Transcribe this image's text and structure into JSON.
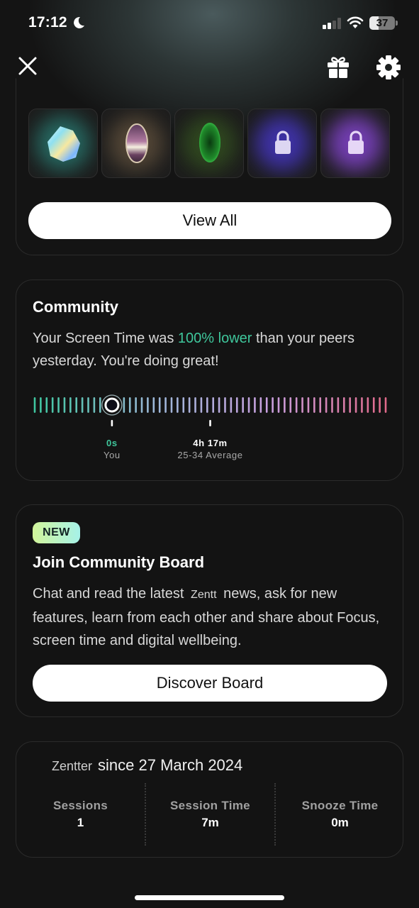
{
  "status_bar": {
    "time": "17:12",
    "battery_level": 37,
    "battery_label": "37",
    "focus_mode_icon": "moon-icon",
    "signal_bars": 2,
    "signal_max": 4
  },
  "nav": {
    "close_icon": "close-icon",
    "gift_icon": "gift-icon",
    "settings_icon": "gear-icon"
  },
  "gems": {
    "items": [
      {
        "name": "opal-gem",
        "state": "unlocked",
        "glow": "#3fc7b0"
      },
      {
        "name": "quartz-gem",
        "state": "unlocked",
        "glow": "#9a7a55"
      },
      {
        "name": "emerald-gem",
        "state": "unlocked",
        "glow": "#3f7a2a"
      },
      {
        "name": "locked-gem",
        "state": "locked",
        "glow": "#5b3dff"
      },
      {
        "name": "locked-gem",
        "state": "locked",
        "glow": "#9b4dff"
      }
    ],
    "view_all_label": "View All"
  },
  "community": {
    "title": "Community",
    "text_before": "Your Screen Time was ",
    "highlight": "100% lower",
    "text_after": " than your peers yesterday. You're doing great!",
    "accent_color": "#3fc79c",
    "scale": {
      "tick_count": 60,
      "colors": [
        "#3fc7a0",
        "#9bb8d8",
        "#c9a0e0",
        "#e06a8a"
      ],
      "you_position": 0.22,
      "avg_position": 0.5
    },
    "you": {
      "value": "0s",
      "label": "You"
    },
    "average": {
      "value": "4h 17m",
      "label": "25-34 Average"
    }
  },
  "board": {
    "badge": "NEW",
    "title": "Join Community Board",
    "text_before": "Chat and read the latest",
    "brand": "Zentt",
    "text_after": "news, ask for new features, learn from each other and share about Focus, screen time and digital wellbeing.",
    "button_label": "Discover Board"
  },
  "profile": {
    "brand": "Zentter",
    "since": "since 27 March 2024",
    "stats": [
      {
        "label": "Sessions",
        "value": "1"
      },
      {
        "label": "Session Time",
        "value": "7m"
      },
      {
        "label": "Snooze Time",
        "value": "0m"
      }
    ]
  }
}
